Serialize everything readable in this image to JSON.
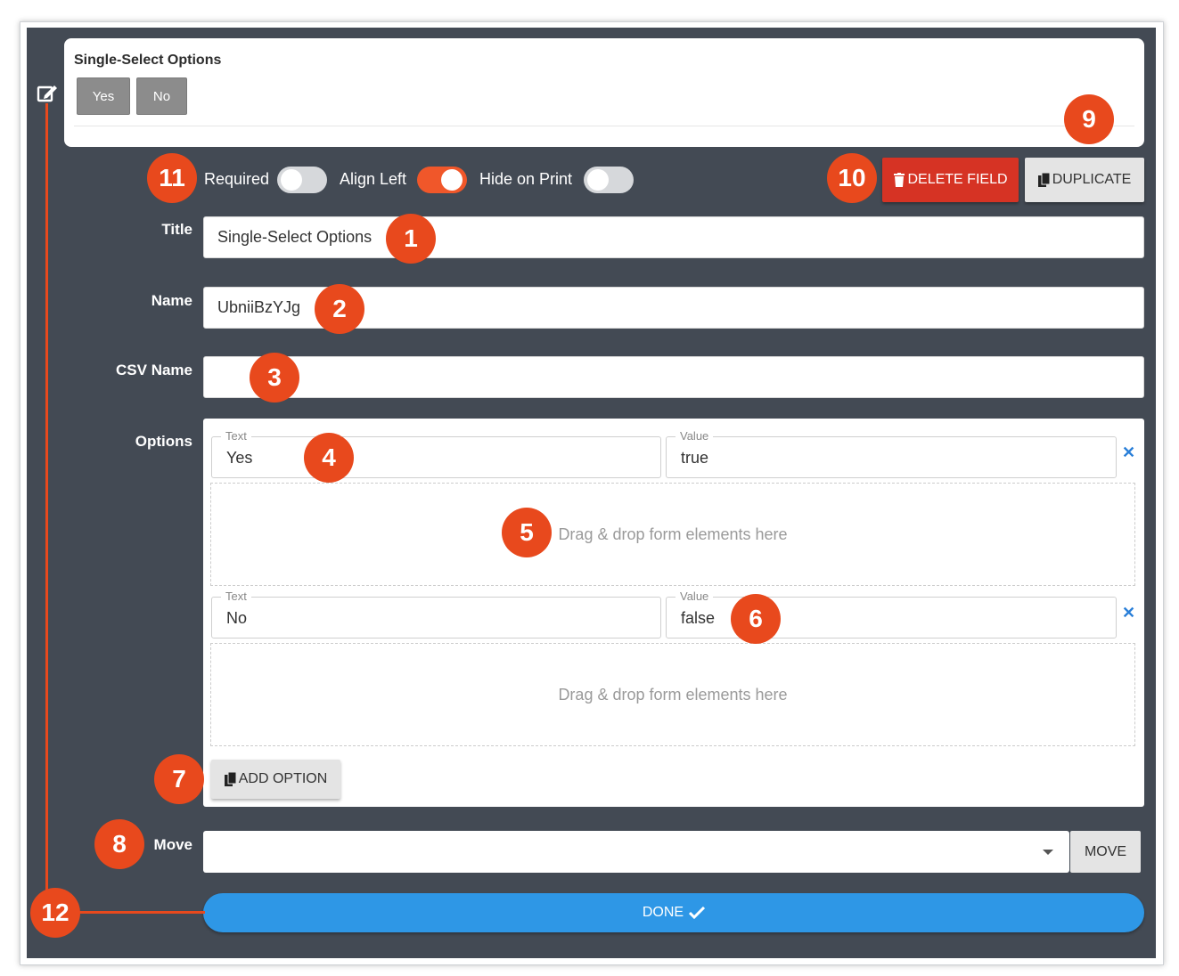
{
  "preview": {
    "title": "Single-Select Options",
    "buttons": [
      "Yes",
      "No"
    ]
  },
  "toggles": {
    "required_label": "Required",
    "required_on": false,
    "align_left_label": "Align Left",
    "align_left_on": true,
    "hide_on_print_label": "Hide on Print",
    "hide_on_print_on": false
  },
  "actions": {
    "delete_label": "DELETE FIELD",
    "duplicate_label": "DUPLICATE"
  },
  "form": {
    "title_label": "Title",
    "title_value": "Single-Select Options",
    "name_label": "Name",
    "name_value": "UbniiBzYJg",
    "csv_label": "CSV Name",
    "csv_value": "",
    "options_label": "Options",
    "move_label": "Move",
    "move_value": ""
  },
  "options": [
    {
      "text_legend": "Text",
      "text": "Yes",
      "value_legend": "Value",
      "value": "true"
    },
    {
      "text_legend": "Text",
      "text": "No",
      "value_legend": "Value",
      "value": "false"
    }
  ],
  "dropzone_text": "Drag & drop form elements here",
  "add_option_label": "ADD OPTION",
  "move_button_label": "MOVE",
  "done_label": "DONE",
  "badges": [
    "1",
    "2",
    "3",
    "4",
    "5",
    "6",
    "7",
    "8",
    "9",
    "10",
    "11",
    "12"
  ],
  "colors": {
    "panel": "#434a54",
    "accent_orange": "#e8491d",
    "delete_red": "#d63324",
    "done_blue": "#2e97e6",
    "toggle_on": "#f0572a",
    "remove_x": "#2a7fd8"
  },
  "icons": {
    "edit": "edit-icon",
    "trash": "trash-icon",
    "copy": "copy-icon",
    "remove": "close-icon",
    "dropdown": "chevron-down-icon",
    "check": "check-icon"
  }
}
